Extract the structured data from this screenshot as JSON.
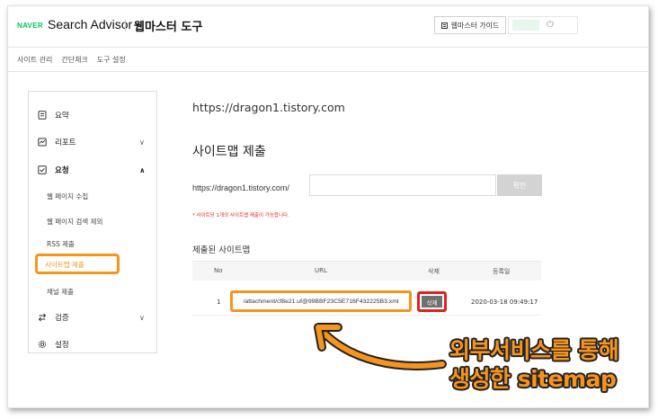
{
  "header": {
    "naver_logo": "NAVER",
    "product": "Search Advisor",
    "tool_title": "웹마스터 도구",
    "guide_button": "웹마스터 가이드"
  },
  "tabs": [
    "사이트 관리",
    "간단체크",
    "도구 설정"
  ],
  "sidebar": {
    "menu": [
      {
        "label": "요약",
        "icon": "summary-icon"
      },
      {
        "label": "리포트",
        "icon": "report-icon",
        "chevron": "∨"
      },
      {
        "label": "요청",
        "icon": "request-icon",
        "chevron": "∧"
      },
      {
        "label": "검증",
        "icon": "verify-icon",
        "chevron": "∨"
      },
      {
        "label": "설정",
        "icon": "gear-icon"
      }
    ],
    "sub_items": [
      "웹 페이지 수집",
      "웹 페이지 검색 제외",
      "RSS 제출",
      "사이트맵 제출",
      "채널 제출"
    ],
    "active_sub": "사이트맵 제출"
  },
  "main": {
    "site_url": "https://dragon1.tistory.com",
    "title": "사이트맵 제출",
    "form_prefix": "https://dragon1.tistory.com/",
    "input_value": "",
    "confirm_button": "확인",
    "notice": "* 사이트당 1개의 사이트맵 제출이 가능합니다.",
    "submitted_title": "제출된 사이트맵",
    "table": {
      "headers": [
        "No",
        "URL",
        "삭제",
        "등록일"
      ],
      "rows": [
        {
          "no": "1",
          "url": "/attachment/cf8e21.uf@99BBF23C5E716F432225B3.xml",
          "delete": "삭제",
          "date": "2020-03-18 09:49:17"
        }
      ]
    }
  },
  "annotation": {
    "line1": "외부서비스를 통해",
    "line2": "생성한 sitemap",
    "color": "#f7941d"
  },
  "colors": {
    "naver_green": "#03c75a",
    "highlight_orange": "#f7941d",
    "highlight_red": "#e02020",
    "notice_red": "#e1261c"
  }
}
